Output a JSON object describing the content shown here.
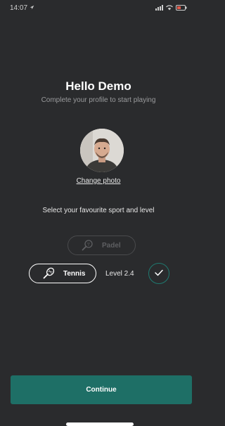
{
  "status": {
    "time": "14:07"
  },
  "profile": {
    "title": "Hello Demo",
    "subtitle": "Complete your profile to start playing",
    "change_photo": "Change photo"
  },
  "sports": {
    "label": "Select your favourite sport and level",
    "items": [
      {
        "name": "Padel",
        "icon": "padel-racket-icon",
        "selected": false
      },
      {
        "name": "Tennis",
        "icon": "tennis-racket-icon",
        "selected": true,
        "level": "Level 2.4"
      }
    ]
  },
  "actions": {
    "continue_label": "Continue"
  },
  "colors": {
    "background": "#2a2b2d",
    "accent": "#1e6f66",
    "check_border": "#1f7a70"
  }
}
